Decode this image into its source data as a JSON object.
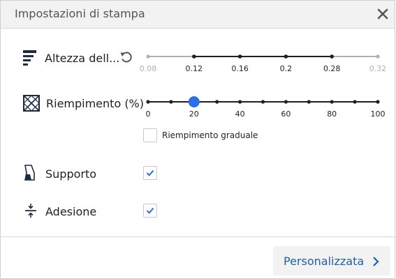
{
  "header": {
    "title": "Impostazioni di stampa",
    "close_icon": "close-icon"
  },
  "layer_height": {
    "label": "Altezza dell...",
    "icon": "layer-height-icon",
    "reset_icon": "reset-icon",
    "ticks": [
      "0.08",
      "0.12",
      "0.16",
      "0.2",
      "0.28",
      "0.32"
    ],
    "active_range": [
      "0.12",
      "0.28"
    ]
  },
  "infill": {
    "label": "Riempimento (%)",
    "icon": "infill-icon",
    "ticks": [
      "0",
      "20",
      "40",
      "60",
      "80",
      "100"
    ],
    "value": 20,
    "gradual_label": "Riempimento graduale",
    "gradual_checked": false
  },
  "support": {
    "label": "Supporto",
    "icon": "support-icon",
    "checked": true
  },
  "adhesion": {
    "label": "Adesione",
    "icon": "adhesion-icon",
    "checked": true
  },
  "footer": {
    "custom_label": "Personalizzata",
    "chevron_icon": "chevron-right-icon"
  },
  "colors": {
    "accent": "#2a6ee8",
    "link": "#1f5fa8",
    "inactive": "#b0b0b0",
    "dark": "#1f1f1f"
  }
}
